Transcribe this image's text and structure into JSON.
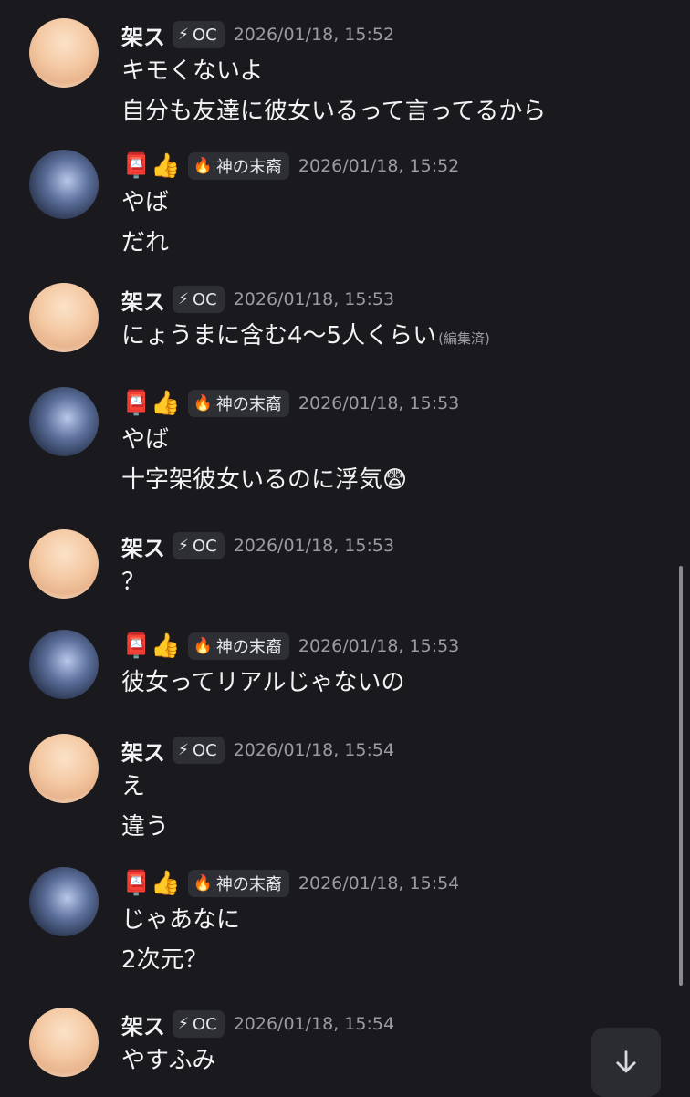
{
  "users": {
    "kasu": {
      "name": "架ス",
      "badge_icon": "⚡",
      "badge_text": "OC",
      "avatar": "anime-girl-blonde-avatar"
    },
    "kami": {
      "name_emojis": "📮👍",
      "badge_icon": "🔥",
      "badge_text": "神の末裔",
      "avatar": "anime-girl-blue-hair-avatar"
    }
  },
  "messages": [
    {
      "user": "kasu",
      "time": "2026/01/18, 15:52",
      "lines": [
        "キモくないよ",
        "自分も友達に彼女いるって言ってるから"
      ]
    },
    {
      "user": "kami",
      "time": "2026/01/18, 15:52",
      "lines": [
        "やば",
        "だれ"
      ]
    },
    {
      "user": "kasu",
      "time": "2026/01/18, 15:53",
      "lines": [
        "にょうまに含む4〜5人くらい"
      ],
      "edited": "(編集済)"
    },
    {
      "user": "kami",
      "time": "2026/01/18, 15:53",
      "lines": [
        "やば",
        "十字架彼女いるのに浮気😨"
      ]
    },
    {
      "user": "kasu",
      "time": "2026/01/18, 15:53",
      "lines": [
        "？"
      ]
    },
    {
      "user": "kami",
      "time": "2026/01/18, 15:53",
      "lines": [
        "彼女ってリアルじゃないの"
      ]
    },
    {
      "user": "kasu",
      "time": "2026/01/18, 15:54",
      "lines": [
        "え",
        "違う"
      ]
    },
    {
      "user": "kami",
      "time": "2026/01/18, 15:54",
      "lines": [
        "じゃあなに",
        "2次元？"
      ]
    },
    {
      "user": "kasu",
      "time": "2026/01/18, 15:54",
      "lines": [
        "やすふみ"
      ]
    }
  ],
  "scroll_button": {
    "icon": "arrow-down-icon"
  },
  "colors": {
    "background": "#1a1a1e",
    "badge_bg": "#2e2f35",
    "timestamp": "#9a9ba3",
    "text": "#f2f3f5"
  }
}
